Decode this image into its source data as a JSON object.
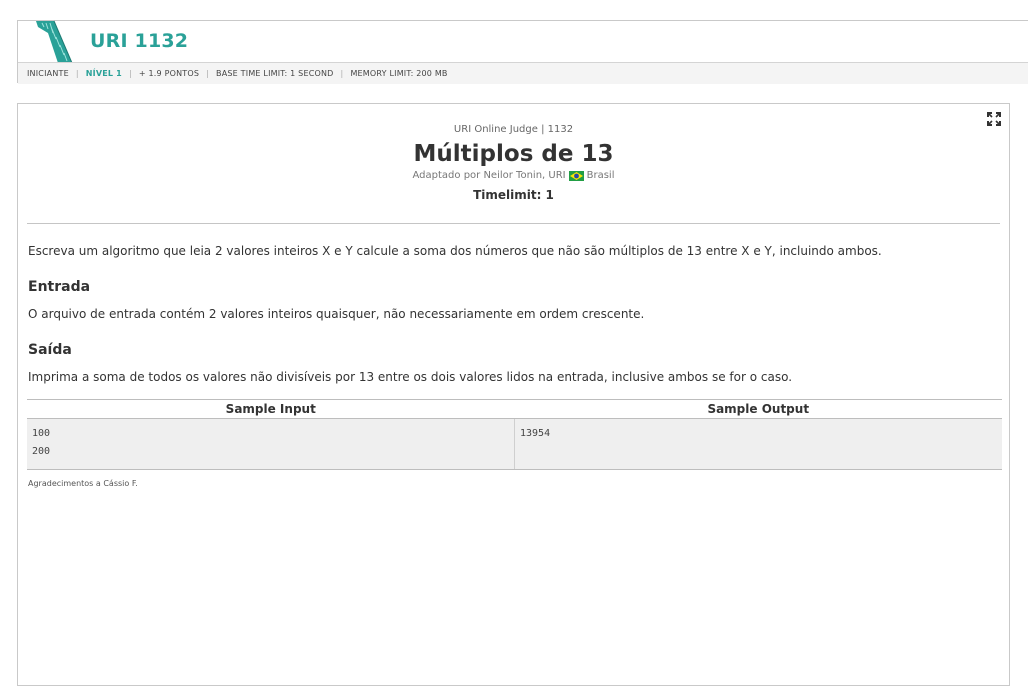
{
  "header": {
    "title": "URI 1132",
    "meta": {
      "category": "INICIANTE",
      "level": "NÍVEL 1",
      "points": "+ 1.9 PONTOS",
      "time_limit": "BASE TIME LIMIT: 1 SECOND",
      "memory_limit": "MEMORY LIMIT: 200 MB"
    },
    "accent_color": "#2aa198"
  },
  "problem": {
    "judge": "URI Online Judge | 1132",
    "title": "Múltiplos de 13",
    "author_prefix": "Adaptado por Neilor Tonin, URI",
    "country": "Brasil",
    "timelimit": "Timelimit: 1",
    "statement": "Escreva um algoritmo que leia 2 valores inteiros X e Y calcule a soma dos números que não são múltiplos de 13 entre X e Y, incluindo ambos.",
    "input_heading": "Entrada",
    "input_text": "O arquivo de entrada contém 2 valores inteiros quaisquer, não necessariamente em ordem crescente.",
    "output_heading": "Saída",
    "output_text": "Imprima a soma de todos os valores não divisíveis por 13 entre os dois valores lidos na entrada, inclusive ambos se for o caso.",
    "sample": {
      "input_header": "Sample Input",
      "output_header": "Sample Output",
      "input": "100\n200",
      "output": "13954"
    },
    "credit": "Agradecimentos a Cássio F."
  },
  "icons": {
    "fullscreen": "expand-icon",
    "logo": "uri-logo",
    "flag": "brazil-flag-icon"
  }
}
